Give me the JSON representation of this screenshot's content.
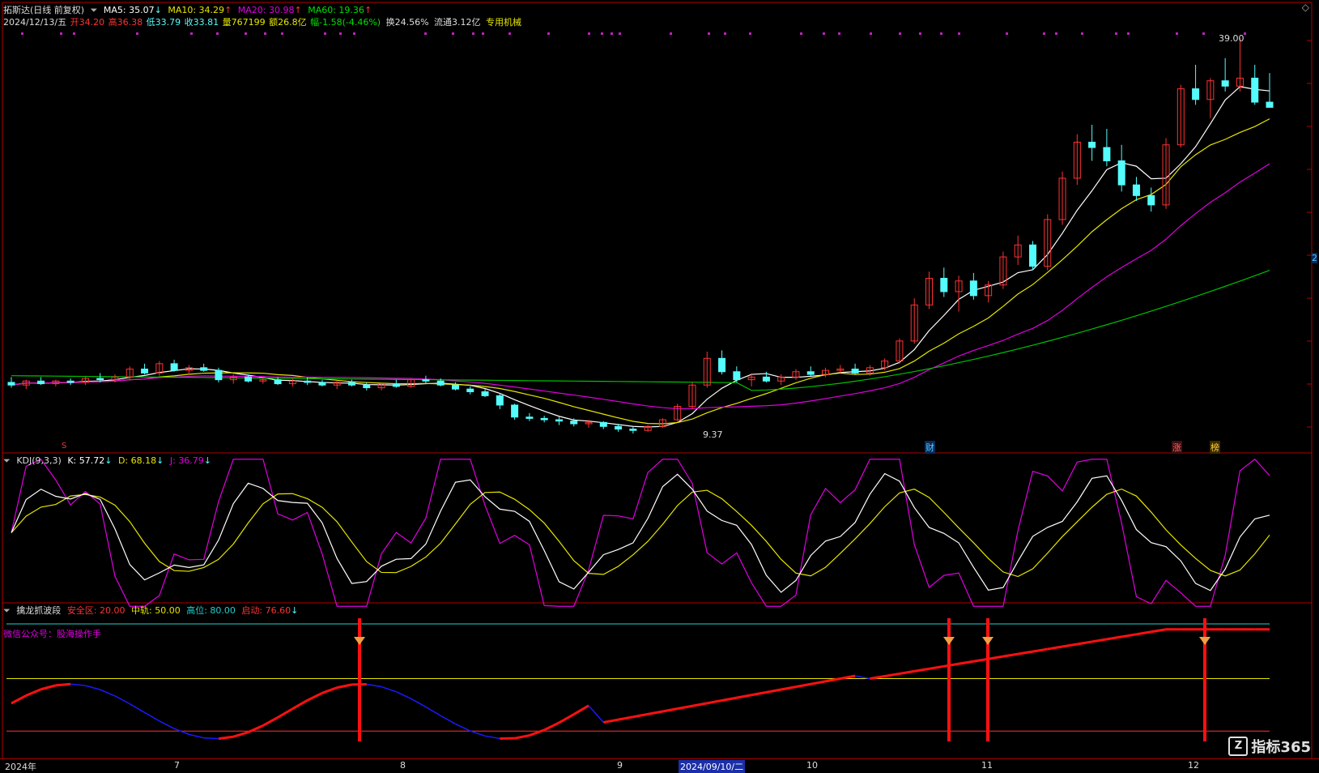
{
  "header": {
    "stock_name": "拓斯达(日线 前复权)",
    "ma5": "MA5: 35.07",
    "ma10": "MA10: 34.29",
    "ma20": "MA20: 30.98",
    "ma60": "MA60: 19.36",
    "date": "2024/12/13/五",
    "open": "开34.20",
    "high": "高36.38",
    "low": "低33.79",
    "close": "收33.81",
    "volume": "量767199",
    "amount": "额26.8亿",
    "change": "幅-1.58(-4.46%)",
    "turnover": "换24.56%",
    "float": "流通3.12亿",
    "sector": "专用机械"
  },
  "price_pane": {
    "high_label": "39.00",
    "low_label": "9.37",
    "markers": {
      "s": "S",
      "cai": "财",
      "zhang": "涨",
      "bang": "榜"
    },
    "right_tag": "2"
  },
  "kdj": {
    "title": "KDJ(9,3,3)",
    "k": "K: 57.72",
    "d": "D: 68.18",
    "j": "J: 36.79"
  },
  "indicator": {
    "title": "擒龙抓波段",
    "safe": "安全区: 20.00",
    "mid": "中轨: 50.00",
    "high": "高位: 80.00",
    "start": "启动: 76.60",
    "wechat": "微信公众号：股海操作手"
  },
  "xaxis": {
    "labels": [
      "2024年",
      "7",
      "8",
      "9",
      "2024/09/10/二",
      "10",
      "11",
      "12"
    ]
  },
  "watermark": "指标365",
  "colors": {
    "ma5": "#ffffff",
    "ma10": "#e6e600",
    "ma20": "#e000e0",
    "ma60": "#00c000",
    "up": "#ff3232",
    "down": "#54fcfc",
    "kdj_k": "#ffffff",
    "kdj_d": "#e6e600",
    "kdj_j": "#e000e0",
    "ind_up": "#ff1010",
    "ind_down": "#1a1aff",
    "border": "#b00000"
  }
}
